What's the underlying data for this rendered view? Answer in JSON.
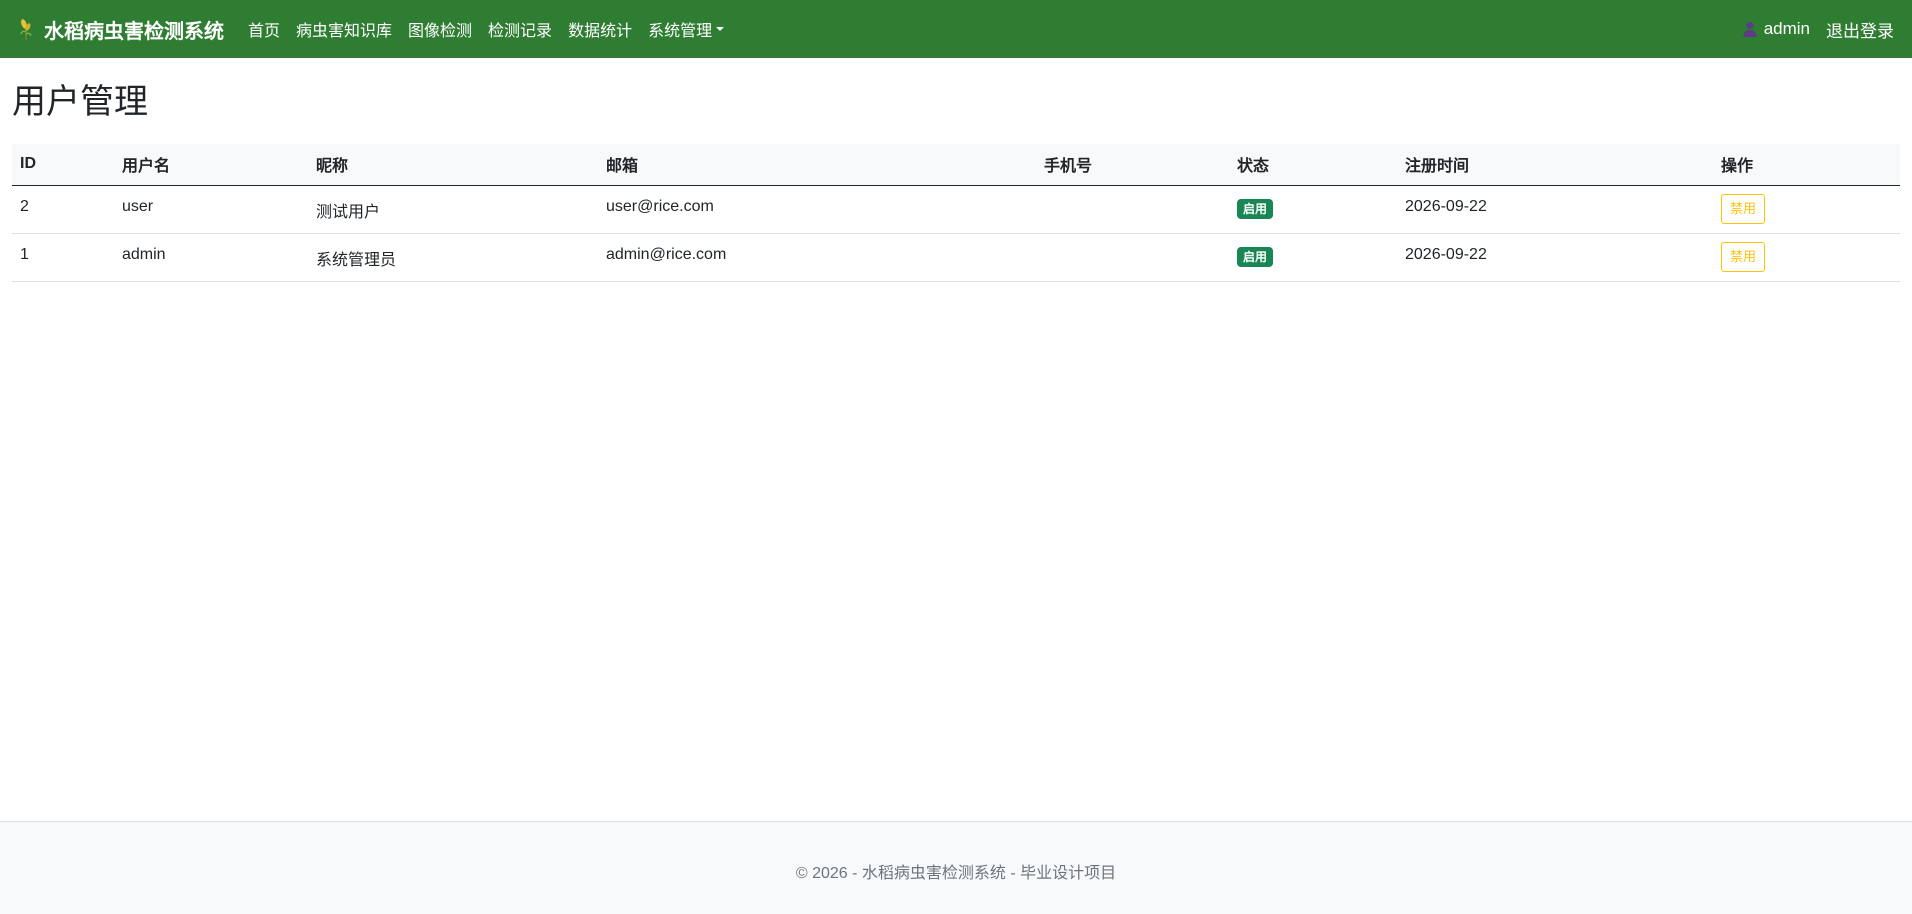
{
  "navbar": {
    "brand": "水稻病虫害检测系统",
    "brand_icon": "rice-plant-icon",
    "links": [
      {
        "label": "首页"
      },
      {
        "label": "病虫害知识库"
      },
      {
        "label": "图像检测"
      },
      {
        "label": "检测记录"
      },
      {
        "label": "数据统计"
      },
      {
        "label": "系统管理",
        "dropdown": true
      }
    ],
    "user": {
      "icon": "user-icon",
      "name": "admin"
    },
    "logout_label": "退出登录",
    "background_color": "#2e7d32"
  },
  "main": {
    "title": "用户管理",
    "table": {
      "headers": [
        "ID",
        "用户名",
        "昵称",
        "邮箱",
        "手机号",
        "状态",
        "注册时间",
        "操作"
      ],
      "rows": [
        {
          "id": "2",
          "username": "user",
          "nickname": "测试用户",
          "email": "user@rice.com",
          "phone": "",
          "status": "启用",
          "registered": "2026-09-22",
          "action": "禁用"
        },
        {
          "id": "1",
          "username": "admin",
          "nickname": "系统管理员",
          "email": "admin@rice.com",
          "phone": "",
          "status": "启用",
          "registered": "2026-09-22",
          "action": "禁用"
        }
      ]
    },
    "status_color": "#198754",
    "action_color": "#ffc107"
  },
  "footer": {
    "text": "© 2026 - 水稻病虫害检测系统 - 毕业设计项目"
  }
}
